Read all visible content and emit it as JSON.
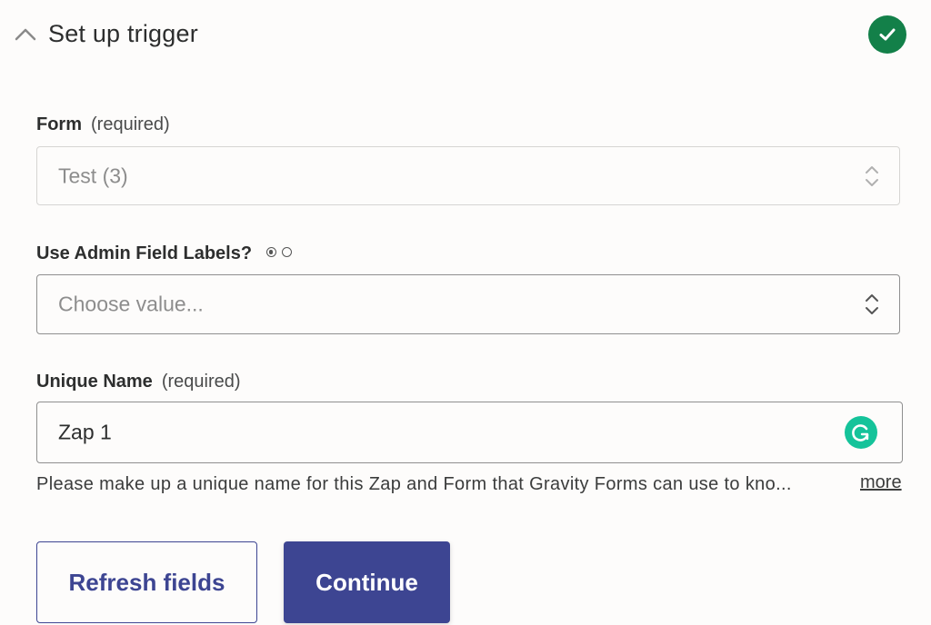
{
  "header": {
    "title": "Set up trigger",
    "collapse_icon": "chevron-up-icon",
    "status_icon": "check-circle-icon",
    "status_color": "#138049"
  },
  "fields": {
    "form": {
      "label": "Form",
      "required_note": "(required)",
      "value": "Test (3)",
      "icon": "updown-chevron-icon"
    },
    "admin_labels": {
      "label": "Use Admin Field Labels?",
      "radio_options": [
        "selected",
        "unselected"
      ],
      "placeholder": "Choose value...",
      "icon": "updown-chevron-icon"
    },
    "unique_name": {
      "label": "Unique Name",
      "required_note": "(required)",
      "value": "Zap 1",
      "grammarly_icon": "grammarly-icon",
      "help_text": "Please make up a unique name for this Zap and Form that Gravity Forms can use to kno...",
      "more_link": "more"
    }
  },
  "buttons": {
    "refresh": "Refresh fields",
    "continue": "Continue"
  },
  "colors": {
    "primary": "#3d4592",
    "success": "#138049",
    "grammarly": "#15c39a"
  }
}
